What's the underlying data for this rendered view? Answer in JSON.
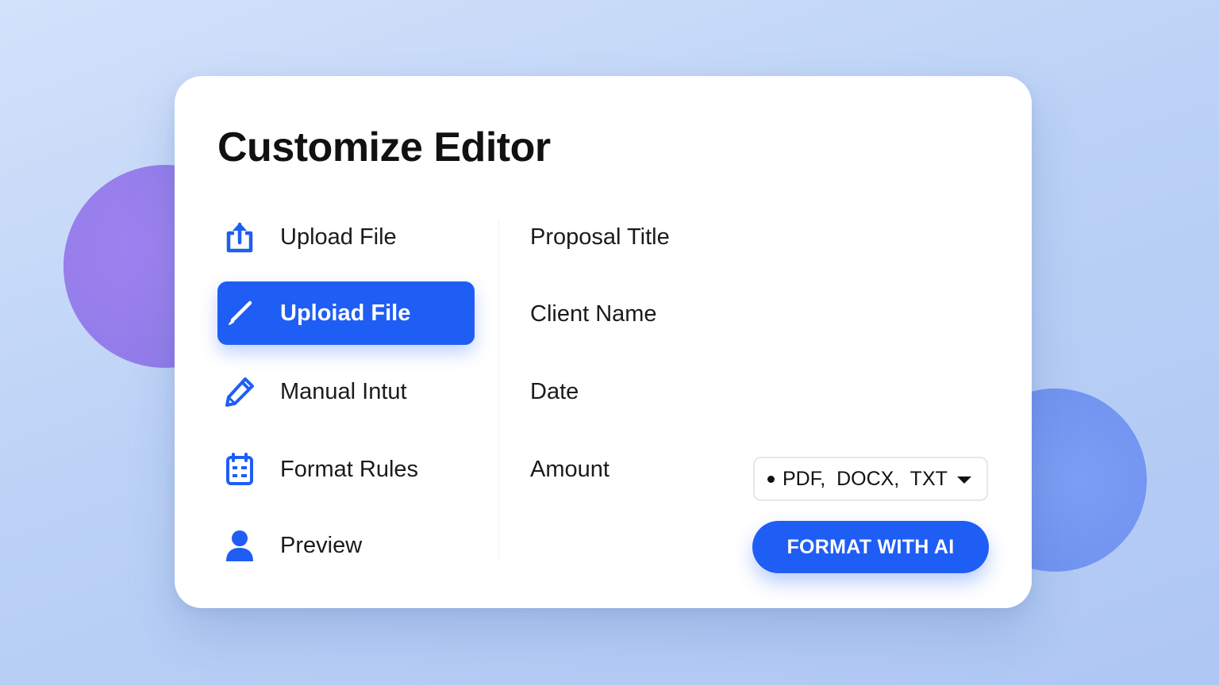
{
  "editor": {
    "title": "Customize Editor"
  },
  "nav": {
    "items": [
      {
        "label": "Upload File",
        "icon": "upload-icon",
        "active": false
      },
      {
        "label": "Uploiad File",
        "icon": "pen-icon",
        "active": true
      },
      {
        "label": "Manual Intut",
        "icon": "pencil-icon",
        "active": false
      },
      {
        "label": "Format Rules",
        "icon": "calendar-list-icon",
        "active": false
      },
      {
        "label": "Preview",
        "icon": "user-icon",
        "active": false
      }
    ]
  },
  "fields": {
    "proposal_title": "Proposal Title",
    "client_name": "Client Name",
    "date": "Date",
    "amount": "Amount"
  },
  "format_select": {
    "value": "PDF,  DOCX,  TXT"
  },
  "actions": {
    "format_button": "FORMAT WITH AI"
  },
  "colors": {
    "accent": "#1f5ef5",
    "background": "#c3d6f7",
    "blob_left": "#9580ec",
    "blob_right": "#7395f1"
  }
}
